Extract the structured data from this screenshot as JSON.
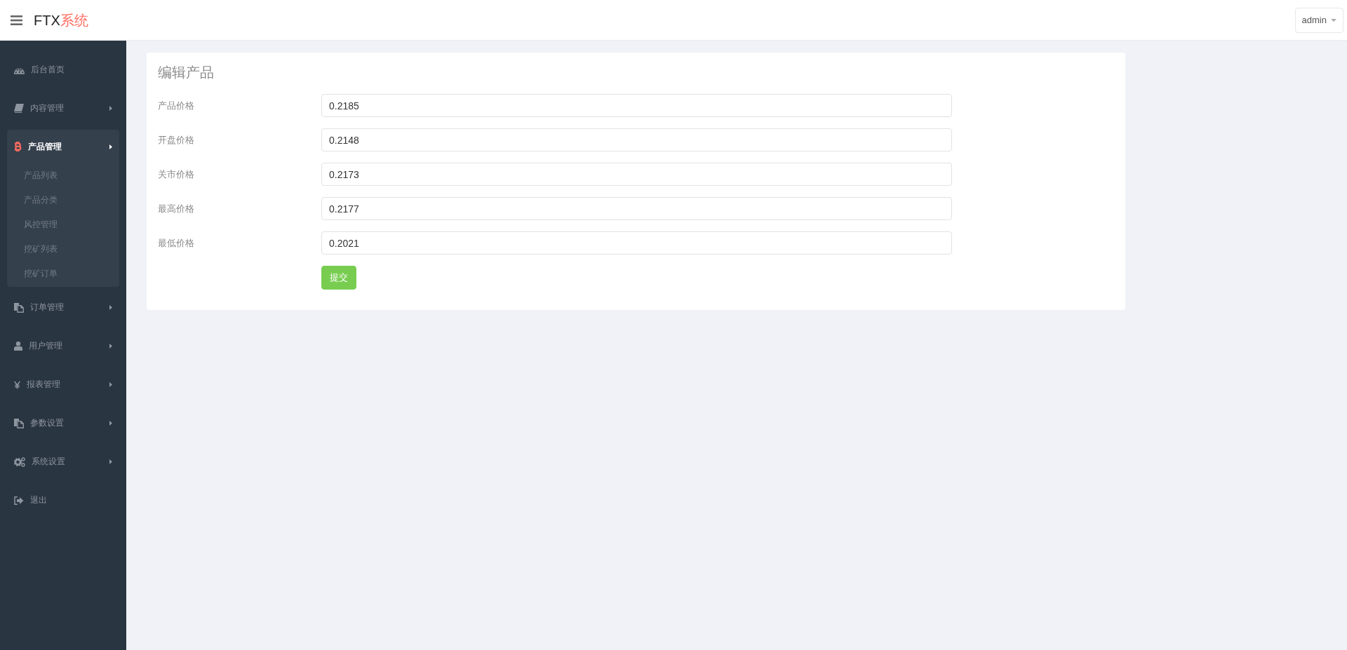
{
  "header": {
    "brand": {
      "text": "FTX",
      "accent": "系统"
    },
    "user_menu": {
      "label": "admin"
    }
  },
  "sidebar": {
    "items": [
      {
        "label": "后台首页",
        "kind": "link",
        "selected": false
      },
      {
        "label": "内容管理",
        "kind": "submenu",
        "expanded": false,
        "selected": false
      },
      {
        "label": "产品管理",
        "kind": "submenu",
        "expanded": true,
        "selected": true,
        "children": [
          {
            "label": "产品列表",
            "selected": false
          },
          {
            "label": "产品分类",
            "selected": false
          },
          {
            "label": "风控管理",
            "selected": false
          },
          {
            "label": "挖矿列表",
            "selected": false
          },
          {
            "label": "挖矿订单",
            "selected": false
          }
        ]
      },
      {
        "label": "订单管理",
        "kind": "submenu",
        "expanded": false,
        "selected": false
      },
      {
        "label": "用户管理",
        "kind": "submenu",
        "expanded": false,
        "selected": false
      },
      {
        "label": "报表管理",
        "kind": "submenu",
        "expanded": false,
        "selected": false
      },
      {
        "label": "参数设置",
        "kind": "submenu",
        "expanded": false,
        "selected": false
      },
      {
        "label": "系统设置",
        "kind": "submenu",
        "expanded": false,
        "selected": false
      },
      {
        "label": "退出",
        "kind": "link",
        "selected": false
      }
    ]
  },
  "form": {
    "title": "编辑产品",
    "fields": [
      {
        "label": "产品价格",
        "value": "0.2185"
      },
      {
        "label": "开盘价格",
        "value": "0.2148"
      },
      {
        "label": "关市价格",
        "value": "0.2173"
      },
      {
        "label": "最高价格",
        "value": "0.2177"
      },
      {
        "label": "最低价格",
        "value": "0.2021"
      }
    ],
    "submit": "提交"
  }
}
